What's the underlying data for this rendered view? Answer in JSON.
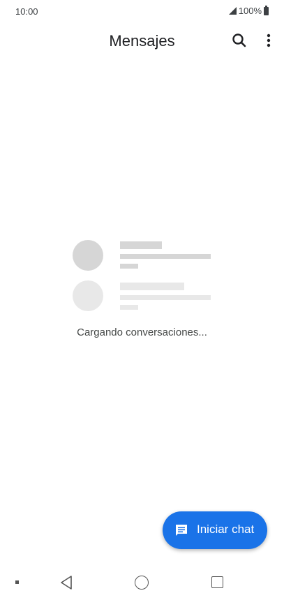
{
  "status_bar": {
    "time": "10:00",
    "battery": "100%"
  },
  "header": {
    "title": "Mensajes",
    "search_icon": "search-icon",
    "menu_icon": "more-vert-icon"
  },
  "main": {
    "loading_text": "Cargando conversaciones..."
  },
  "fab": {
    "label": "Iniciar chat",
    "icon": "chat-icon"
  },
  "nav": {
    "back_icon": "back-triangle-icon",
    "home_icon": "home-circle-icon",
    "recents_icon": "recents-square-icon"
  },
  "colors": {
    "accent": "#1a73e8",
    "skeleton_dark": "#d6d6d6",
    "skeleton_light": "#e8e8e8"
  }
}
